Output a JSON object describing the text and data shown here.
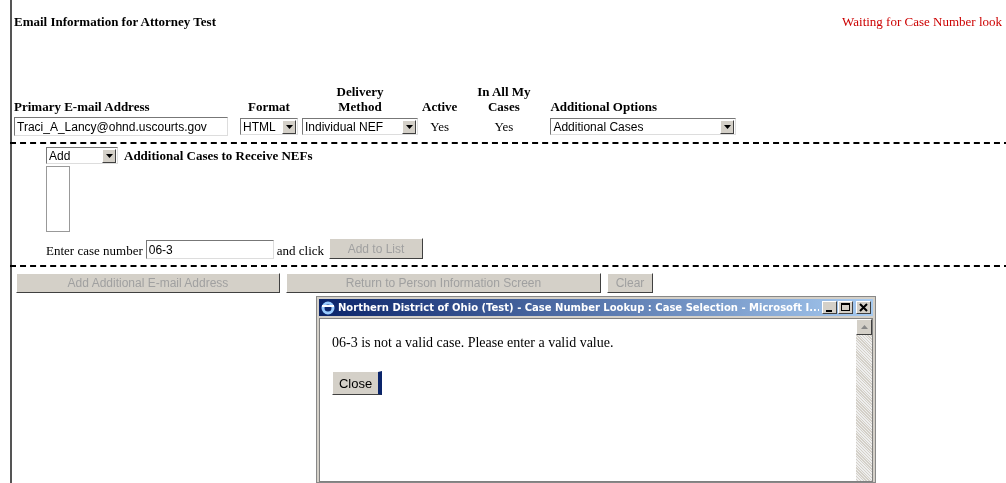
{
  "page": {
    "title": "Email Information for Attorney Test",
    "status": "Waiting for Case Number look"
  },
  "email_table": {
    "columns": [
      {
        "label": "Primary E-mail Address"
      },
      {
        "label": "Format"
      },
      {
        "label": "Delivery Method"
      },
      {
        "label": "Active"
      },
      {
        "label": "In All My Cases"
      },
      {
        "label": "Additional Options"
      }
    ],
    "row": {
      "email": "Traci_A_Lancy@ohnd.uscourts.gov",
      "format": "HTML",
      "delivery_method": "Individual NEF",
      "active": "Yes",
      "in_all_my_cases": "Yes",
      "additional_options": "Additional Cases"
    }
  },
  "additional_cases": {
    "action": "Add",
    "heading": "Additional Cases to Receive NEFs",
    "case_label": "Enter case number",
    "case_value": "06-3",
    "and_click": "and click",
    "add_button": {
      "label": "Add to List",
      "disabled": true
    }
  },
  "buttons": [
    {
      "label": "Add Additional E-mail Address",
      "disabled": true
    },
    {
      "label": "Return to Person Information Screen",
      "disabled": true
    },
    {
      "label": "Clear",
      "disabled": true
    }
  ],
  "popup": {
    "title": "Northern District of Ohio (Test) - Case Number Lookup : Case Selection - Microsoft I...",
    "message": "06-3 is not a valid case. Please enter a valid value.",
    "close_button": {
      "label": "Close",
      "disabled": false
    }
  }
}
